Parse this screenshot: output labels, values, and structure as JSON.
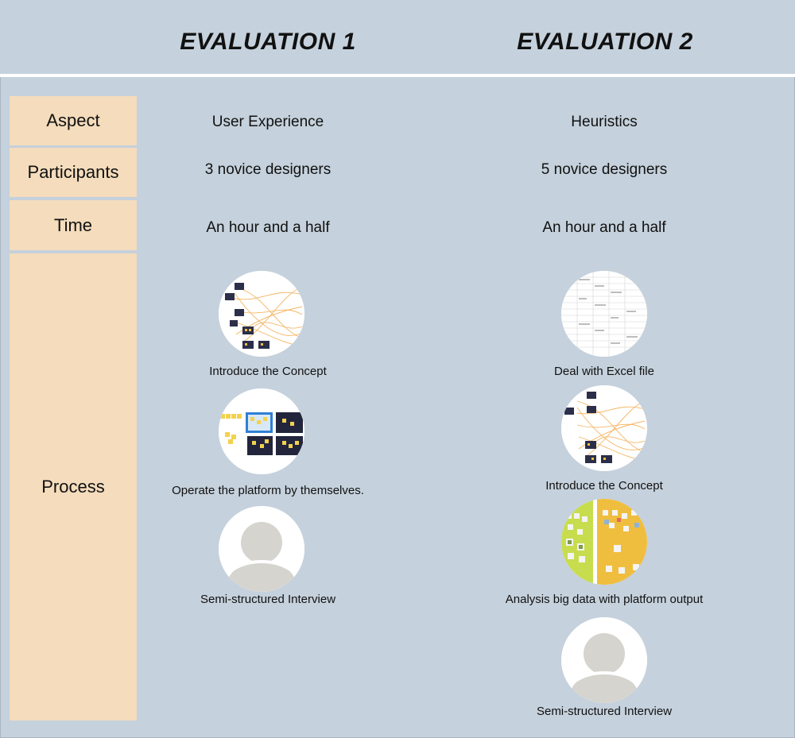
{
  "header": {
    "eval1_title": "EVALUATION 1",
    "eval2_title": "EVALUATION 2"
  },
  "rows": {
    "aspect": {
      "label": "Aspect",
      "eval1": "User Experience",
      "eval2": "Heuristics"
    },
    "participants": {
      "label": "Participants",
      "eval1": "3 novice designers",
      "eval2": "5 novice designers"
    },
    "time": {
      "label": "Time",
      "eval1": "An hour and a half",
      "eval2": "An hour and a half"
    },
    "process": {
      "label": "Process"
    }
  },
  "process": {
    "eval1": [
      {
        "caption": "Introduce the Concept",
        "icon": "concept-network-icon"
      },
      {
        "caption": "Operate the platform by themselves.",
        "icon": "platform-screens-icon"
      },
      {
        "caption": "Semi-structured Interview",
        "icon": "person-avatar-icon"
      }
    ],
    "eval2": [
      {
        "caption": "Deal with Excel file",
        "icon": "spreadsheet-icon"
      },
      {
        "caption": "Introduce the Concept",
        "icon": "concept-network-icon"
      },
      {
        "caption": "Analysis big data with platform output",
        "icon": "sticky-board-icon"
      },
      {
        "caption": "Semi-structured Interview",
        "icon": "person-avatar-icon"
      }
    ]
  },
  "colors": {
    "background": "#c5d1dc",
    "label_fill": "#f4dcbc",
    "divider": "#ffffff"
  }
}
